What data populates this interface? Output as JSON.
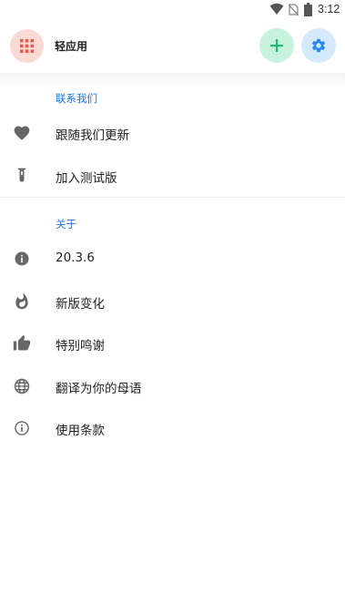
{
  "status_bar": {
    "time": "3:12",
    "icons": [
      "wifi-icon",
      "no-sim-icon",
      "battery-icon"
    ]
  },
  "app_bar": {
    "title": "轻应用",
    "logo_icon": "grid-dots-icon",
    "add_icon": "plus-icon",
    "settings_icon": "gear-icon"
  },
  "colors": {
    "accent": "#1a73e8",
    "logo_bg": "#fbd9d5",
    "logo_fg": "#e8594a",
    "add_bg": "#c7f2dc",
    "add_fg": "#22b573",
    "settings_bg": "#d4e9fb",
    "settings_fg": "#2b8ae8",
    "icon_gray": "#666666"
  },
  "sections": [
    {
      "header": "联系我们",
      "items": [
        {
          "label": "跟随我们更新",
          "icon": "heart-icon"
        },
        {
          "label": "加入测试版",
          "icon": "test-tube-icon"
        }
      ]
    },
    {
      "header": "关于",
      "items": [
        {
          "label": "20.3.6",
          "icon": "info-filled-icon"
        },
        {
          "label": "新版变化",
          "icon": "fire-icon"
        },
        {
          "label": "特别鸣谢",
          "icon": "thumb-up-icon"
        },
        {
          "label": "翻译为你的母语",
          "icon": "globe-icon"
        },
        {
          "label": "使用条款",
          "icon": "info-outline-icon"
        }
      ]
    }
  ]
}
